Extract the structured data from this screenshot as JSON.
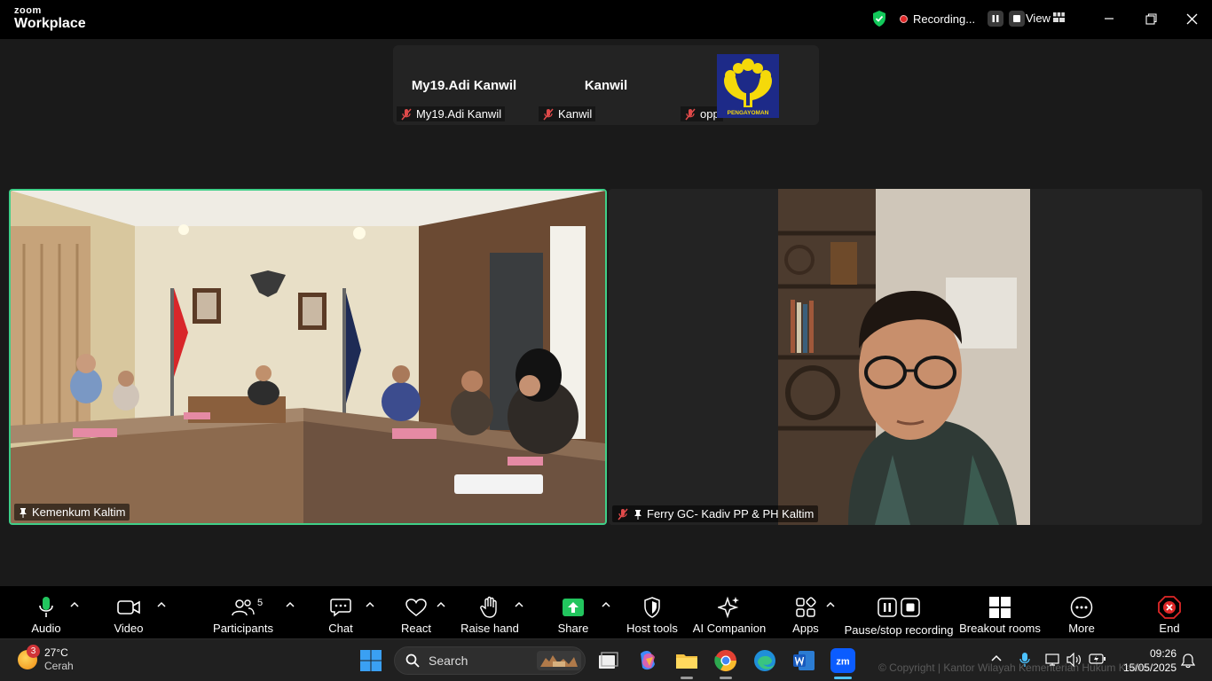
{
  "app": {
    "brand_top": "zoom",
    "brand_name": "Workplace"
  },
  "recording": {
    "status": "Recording..."
  },
  "view": {
    "label": "View"
  },
  "colors": {
    "accent_green": "#3fcf88",
    "share_green": "#22c55e",
    "end_red": "#e02828",
    "shield_green": "#12c95a"
  },
  "thumbnails": [
    {
      "display_name": "My19.Adi Kanwil",
      "label": "My19.Adi Kanwil",
      "muted": true
    },
    {
      "display_name": "Kanwil",
      "label": "Kanwil",
      "muted": true
    },
    {
      "display_name": "",
      "label": "opp",
      "muted": true,
      "logo_text": "PENGAYOMAN"
    }
  ],
  "tiles": [
    {
      "label": "Kemenkum Kaltim",
      "pinned": true,
      "muted": false,
      "active_speaker": true
    },
    {
      "label": "Ferry GC- Kadiv PP & PH Kaltim",
      "pinned": true,
      "muted": true,
      "active_speaker": false
    }
  ],
  "toolbar": {
    "audio": "Audio",
    "video": "Video",
    "participants": "Participants",
    "participants_count": "5",
    "chat": "Chat",
    "react": "React",
    "raise_hand": "Raise hand",
    "share": "Share",
    "host_tools": "Host tools",
    "ai_companion": "AI Companion",
    "apps": "Apps",
    "pause_stop": "Pause/stop recording",
    "breakout": "Breakout rooms",
    "more": "More",
    "end": "End"
  },
  "taskbar": {
    "weather_temp": "27°C",
    "weather_desc": "Cerah",
    "weather_badge": "3",
    "search_placeholder": "Search",
    "time": "09:26",
    "date": "15/05/2025",
    "watermark": "© Copyright | Kantor Wilayah Kementerian Hukum Kaltim"
  }
}
